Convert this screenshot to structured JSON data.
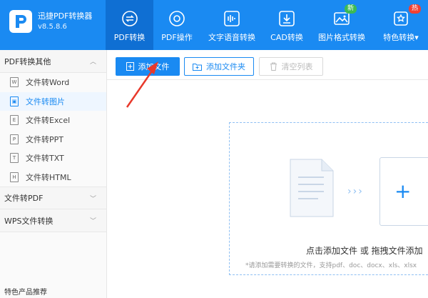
{
  "app": {
    "name": "迅捷PDF转换器",
    "version": "v8.5.8.6"
  },
  "nav": [
    {
      "label": "PDF转换",
      "icon": "refresh-circle-icon",
      "active": true
    },
    {
      "label": "PDF操作",
      "icon": "gear-circle-icon"
    },
    {
      "label": "文字语音转换",
      "icon": "audio-wave-icon"
    },
    {
      "label": "CAD转换",
      "icon": "cad-download-icon"
    },
    {
      "label": "图片格式转换",
      "icon": "image-icon",
      "badge": "新"
    },
    {
      "label": "特色转换",
      "icon": "star-box-icon",
      "badge": "热",
      "dropdown": "▾"
    }
  ],
  "sidebar": {
    "group1": {
      "title": "PDF转换其他",
      "chevron": "︿"
    },
    "items": [
      {
        "label": "文件转Word",
        "icon": "W"
      },
      {
        "label": "文件转图片",
        "icon": "▣",
        "active": true
      },
      {
        "label": "文件转Excel",
        "icon": "E"
      },
      {
        "label": "文件转PPT",
        "icon": "P"
      },
      {
        "label": "文件转TXT",
        "icon": "T"
      },
      {
        "label": "文件转HTML",
        "icon": "H"
      }
    ],
    "group2": {
      "title": "文件转PDF",
      "chevron": "﹀"
    },
    "group3": {
      "title": "WPS文件转换",
      "chevron": "﹀"
    },
    "footer": "特色产品推荐"
  },
  "toolbar": {
    "add_file": "添加文件",
    "add_folder": "添加文件夹",
    "clear_list": "清空列表"
  },
  "dropzone": {
    "title": "点击添加文件 或 拖拽文件添加",
    "hint": "*请添加需要转换的文件，支持pdf、doc、docx、xls、xlsx"
  },
  "colors": {
    "primary": "#1a8af2",
    "annotation": "#e8392b"
  }
}
